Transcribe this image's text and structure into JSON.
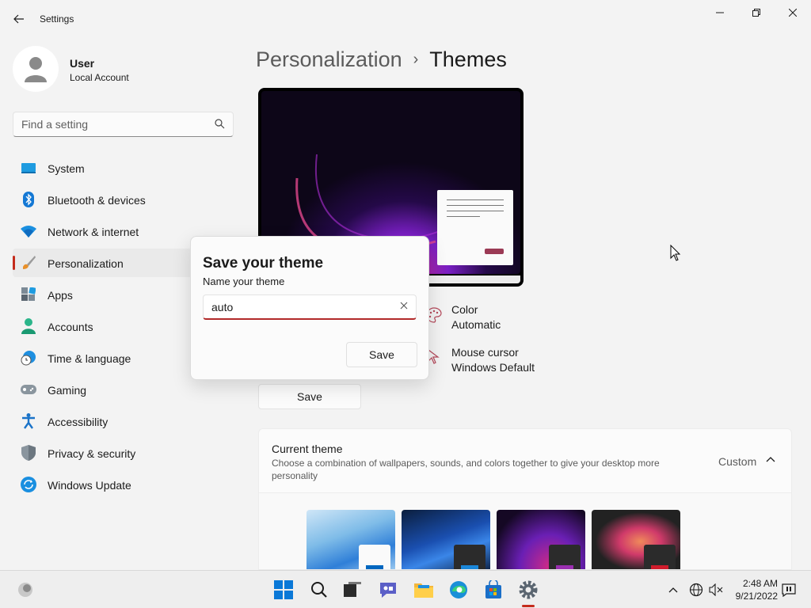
{
  "window": {
    "title": "Settings"
  },
  "user": {
    "name": "User",
    "account_type": "Local Account"
  },
  "search": {
    "placeholder": "Find a setting"
  },
  "sidebar": {
    "items": [
      {
        "label": "System",
        "icon": "system-icon"
      },
      {
        "label": "Bluetooth & devices",
        "icon": "bluetooth-icon"
      },
      {
        "label": "Network & internet",
        "icon": "wifi-icon"
      },
      {
        "label": "Personalization",
        "icon": "paintbrush-icon",
        "active": true
      },
      {
        "label": "Apps",
        "icon": "apps-icon"
      },
      {
        "label": "Accounts",
        "icon": "accounts-icon"
      },
      {
        "label": "Time & language",
        "icon": "clock-globe-icon"
      },
      {
        "label": "Gaming",
        "icon": "gamepad-icon"
      },
      {
        "label": "Accessibility",
        "icon": "accessibility-icon"
      },
      {
        "label": "Privacy & security",
        "icon": "shield-icon"
      },
      {
        "label": "Windows Update",
        "icon": "update-icon"
      }
    ]
  },
  "breadcrumb": {
    "parent": "Personalization",
    "separator": "›",
    "current": "Themes"
  },
  "theme_props": {
    "color_label": "Color",
    "color_value": "Automatic",
    "cursor_label": "Mouse cursor",
    "cursor_value": "Windows Default"
  },
  "main": {
    "save_label": "Save"
  },
  "current_theme": {
    "title": "Current theme",
    "description": "Choose a combination of wallpapers, sounds, and colors together to give your desktop more personality",
    "value": "Custom"
  },
  "dialog": {
    "title": "Save your theme",
    "field_label": "Name your theme",
    "field_value": "auto",
    "save_label": "Save"
  },
  "taskbar": {
    "time": "2:48 AM",
    "date": "9/21/2022"
  },
  "colors": {
    "accent": "#c42b1c",
    "background": "#f3f3f3"
  }
}
